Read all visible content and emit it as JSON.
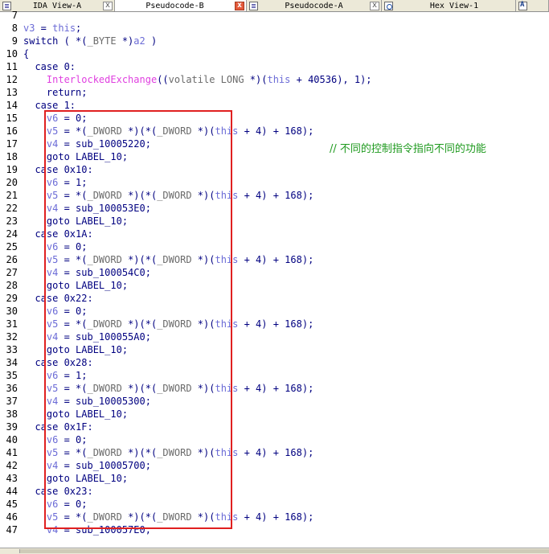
{
  "tabs": [
    {
      "label": "IDA View-A",
      "icon": "listing-icon",
      "close": "x",
      "active": false
    },
    {
      "label": "Pseudocode-B",
      "icon": "none",
      "close": "x",
      "active": true
    },
    {
      "label": "Pseudocode-A",
      "icon": "listing-icon",
      "close": "x",
      "active": false
    },
    {
      "label": "Hex View-1",
      "icon": "hex-icon",
      "close": "",
      "active": false
    },
    {
      "label": "",
      "icon": "structures-icon",
      "close": "",
      "active": false
    }
  ],
  "lines": [
    {
      "n": "7",
      "text": ""
    },
    {
      "n": "8",
      "text": "v3 = this;"
    },
    {
      "n": "9",
      "text": "switch ( *(_BYTE *)a2 )"
    },
    {
      "n": "10",
      "text": "{"
    },
    {
      "n": "11",
      "text": "  case 0:"
    },
    {
      "n": "12",
      "text": "    InterlockedExchange((volatile LONG *)(this + 40536), 1);"
    },
    {
      "n": "13",
      "text": "    return;"
    },
    {
      "n": "14",
      "text": "  case 1:"
    },
    {
      "n": "15",
      "text": "    v6 = 0;"
    },
    {
      "n": "16",
      "text": "    v5 = *(_DWORD *)(*(_DWORD *)(this + 4) + 168);"
    },
    {
      "n": "17",
      "text": "    v4 = sub_10005220;"
    },
    {
      "n": "18",
      "text": "    goto LABEL_10;"
    },
    {
      "n": "19",
      "text": "  case 0x10:"
    },
    {
      "n": "20",
      "text": "    v6 = 1;"
    },
    {
      "n": "21",
      "text": "    v5 = *(_DWORD *)(*(_DWORD *)(this + 4) + 168);"
    },
    {
      "n": "22",
      "text": "    v4 = sub_100053E0;"
    },
    {
      "n": "23",
      "text": "    goto LABEL_10;"
    },
    {
      "n": "24",
      "text": "  case 0x1A:"
    },
    {
      "n": "25",
      "text": "    v6 = 0;"
    },
    {
      "n": "26",
      "text": "    v5 = *(_DWORD *)(*(_DWORD *)(this + 4) + 168);"
    },
    {
      "n": "27",
      "text": "    v4 = sub_100054C0;"
    },
    {
      "n": "28",
      "text": "    goto LABEL_10;"
    },
    {
      "n": "29",
      "text": "  case 0x22:"
    },
    {
      "n": "30",
      "text": "    v6 = 0;"
    },
    {
      "n": "31",
      "text": "    v5 = *(_DWORD *)(*(_DWORD *)(this + 4) + 168);"
    },
    {
      "n": "32",
      "text": "    v4 = sub_100055A0;"
    },
    {
      "n": "33",
      "text": "    goto LABEL_10;"
    },
    {
      "n": "34",
      "text": "  case 0x28:"
    },
    {
      "n": "35",
      "text": "    v6 = 1;"
    },
    {
      "n": "36",
      "text": "    v5 = *(_DWORD *)(*(_DWORD *)(this + 4) + 168);"
    },
    {
      "n": "37",
      "text": "    v4 = sub_10005300;"
    },
    {
      "n": "38",
      "text": "    goto LABEL_10;"
    },
    {
      "n": "39",
      "text": "  case 0x1F:"
    },
    {
      "n": "40",
      "text": "    v6 = 0;"
    },
    {
      "n": "41",
      "text": "    v5 = *(_DWORD *)(*(_DWORD *)(this + 4) + 168);"
    },
    {
      "n": "42",
      "text": "    v4 = sub_10005700;"
    },
    {
      "n": "43",
      "text": "    goto LABEL_10;"
    },
    {
      "n": "44",
      "text": "  case 0x23:"
    },
    {
      "n": "45",
      "text": "    v6 = 0;"
    },
    {
      "n": "46",
      "text": "    v5 = *(_DWORD *)(*(_DWORD *)(this + 4) + 168);"
    },
    {
      "n": "47",
      "text": "    v4 = sub_100057E0;"
    }
  ],
  "comment": "// 不同的控制指令指向不同的功能",
  "colors": {
    "default_code": "#000080",
    "this_keyword": "#6b6bd6",
    "function_call": "#e040e0",
    "comment": "#1f9a1f",
    "annotation_box": "#e02020"
  }
}
